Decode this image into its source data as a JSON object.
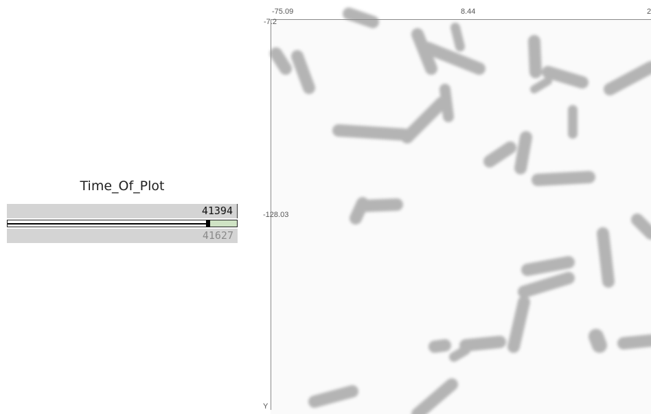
{
  "slider": {
    "title": "Time_Of_Plot",
    "current_value": "41394",
    "max_value": "41627",
    "position": 0.87
  },
  "plot": {
    "x_ticks": [
      "-75.09",
      "8.44",
      "2"
    ],
    "y_ticks": [
      "-7.2",
      "-128.03"
    ],
    "y_axis_label": "Y"
  },
  "colors": {
    "slider_bg": "#d4d4d4",
    "slider_remaining": "#cfe3c4",
    "particle": "#9a9a9a",
    "plot_bg": "#fafafa"
  }
}
